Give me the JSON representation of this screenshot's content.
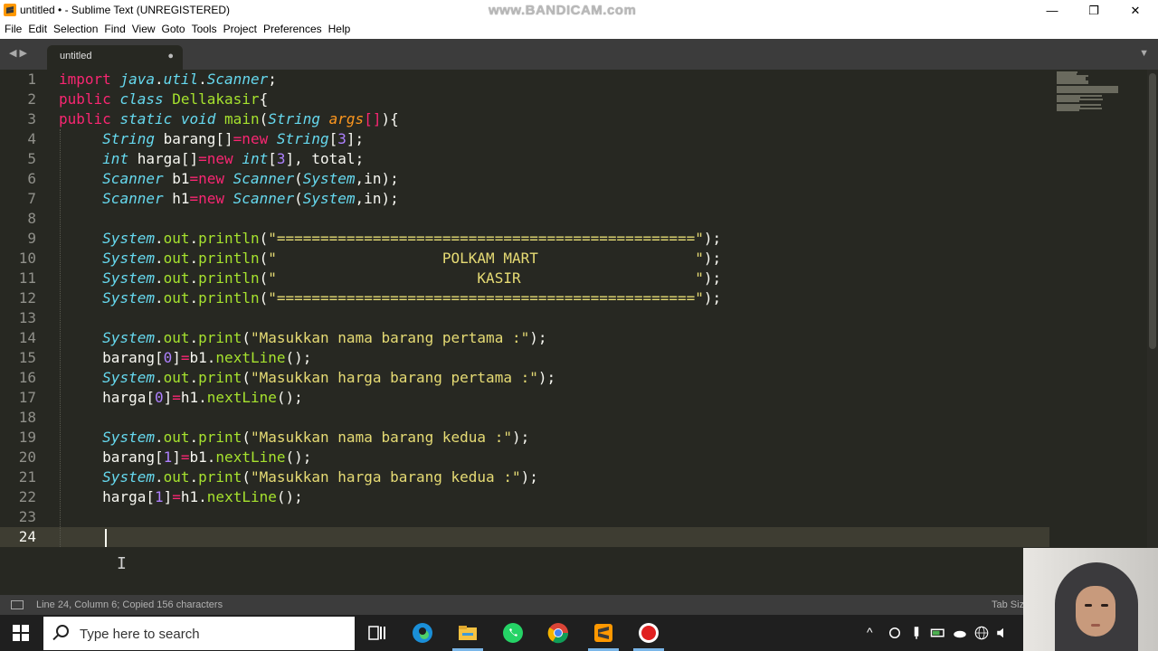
{
  "window": {
    "title": "untitled • - Sublime Text (UNREGISTERED)",
    "watermark": "www.BANDICAM.com",
    "minimize_glyph": "—",
    "maximize_glyph": "❐",
    "close_glyph": "✕"
  },
  "menu": [
    "File",
    "Edit",
    "Selection",
    "Find",
    "View",
    "Goto",
    "Tools",
    "Project",
    "Preferences",
    "Help"
  ],
  "tabbar": {
    "nav_glyph": "◀ ▶",
    "tab_label": "untitled",
    "tab_dirty_glyph": "●",
    "dropdown_glyph": "▼"
  },
  "editor": {
    "line_numbers": [
      "1",
      "2",
      "3",
      "4",
      "5",
      "6",
      "7",
      "8",
      "9",
      "10",
      "11",
      "12",
      "13",
      "14",
      "15",
      "16",
      "17",
      "18",
      "19",
      "20",
      "21",
      "22",
      "23",
      "24"
    ],
    "current_line": "24",
    "code_lines": [
      [
        [
          "k",
          "import "
        ],
        [
          "t",
          "java"
        ],
        [
          "",
          "."
        ],
        [
          "t",
          "util"
        ],
        [
          "",
          "."
        ],
        [
          "t",
          "Scanner"
        ],
        [
          "",
          ";"
        ]
      ],
      [
        [
          "k",
          "public "
        ],
        [
          "t",
          "class "
        ],
        [
          "f",
          "Dellakasir"
        ],
        [
          "",
          "{"
        ]
      ],
      [
        [
          "k",
          "public "
        ],
        [
          "t",
          "static "
        ],
        [
          "t",
          "void "
        ],
        [
          "f",
          "main"
        ],
        [
          "",
          "("
        ],
        [
          "t",
          "String "
        ],
        [
          "a",
          "args"
        ],
        [
          "k",
          "[]"
        ],
        [
          "",
          ")"
        ],
        [
          "",
          "{"
        ]
      ],
      [
        [
          "",
          "     "
        ],
        [
          "t",
          "String "
        ],
        [
          "",
          "barang[]"
        ],
        [
          "k",
          "=new "
        ],
        [
          "t",
          "String"
        ],
        [
          "",
          "["
        ],
        [
          "n",
          "3"
        ],
        [
          "",
          "];"
        ]
      ],
      [
        [
          "",
          "     "
        ],
        [
          "t",
          "int "
        ],
        [
          "",
          "harga[]"
        ],
        [
          "k",
          "=new "
        ],
        [
          "t",
          "int"
        ],
        [
          "",
          "["
        ],
        [
          "n",
          "3"
        ],
        [
          "",
          "], total;"
        ]
      ],
      [
        [
          "",
          "     "
        ],
        [
          "t",
          "Scanner "
        ],
        [
          "",
          "b1"
        ],
        [
          "k",
          "=new "
        ],
        [
          "t",
          "Scanner"
        ],
        [
          "",
          "("
        ],
        [
          "t",
          "System"
        ],
        [
          "",
          ",in);"
        ]
      ],
      [
        [
          "",
          "     "
        ],
        [
          "t",
          "Scanner "
        ],
        [
          "",
          "h1"
        ],
        [
          "k",
          "=new "
        ],
        [
          "t",
          "Scanner"
        ],
        [
          "",
          "("
        ],
        [
          "t",
          "System"
        ],
        [
          "",
          ",in);"
        ]
      ],
      [],
      [
        [
          "",
          "     "
        ],
        [
          "t",
          "System"
        ],
        [
          "",
          "."
        ],
        [
          "f",
          "out"
        ],
        [
          "",
          "."
        ],
        [
          "f",
          "println"
        ],
        [
          "",
          "("
        ],
        [
          "s",
          "\"================================================\""
        ],
        [
          "",
          ");"
        ]
      ],
      [
        [
          "",
          "     "
        ],
        [
          "t",
          "System"
        ],
        [
          "",
          "."
        ],
        [
          "f",
          "out"
        ],
        [
          "",
          "."
        ],
        [
          "f",
          "println"
        ],
        [
          "",
          "("
        ],
        [
          "s",
          "\"                   POLKAM MART                  \""
        ],
        [
          "",
          ");"
        ]
      ],
      [
        [
          "",
          "     "
        ],
        [
          "t",
          "System"
        ],
        [
          "",
          "."
        ],
        [
          "f",
          "out"
        ],
        [
          "",
          "."
        ],
        [
          "f",
          "println"
        ],
        [
          "",
          "("
        ],
        [
          "s",
          "\"                       KASIR                    \""
        ],
        [
          "",
          ");"
        ]
      ],
      [
        [
          "",
          "     "
        ],
        [
          "t",
          "System"
        ],
        [
          "",
          "."
        ],
        [
          "f",
          "out"
        ],
        [
          "",
          "."
        ],
        [
          "f",
          "println"
        ],
        [
          "",
          "("
        ],
        [
          "s",
          "\"================================================\""
        ],
        [
          "",
          ");"
        ]
      ],
      [],
      [
        [
          "",
          "     "
        ],
        [
          "t",
          "System"
        ],
        [
          "",
          "."
        ],
        [
          "f",
          "out"
        ],
        [
          "",
          "."
        ],
        [
          "f",
          "print"
        ],
        [
          "",
          "("
        ],
        [
          "s",
          "\"Masukkan nama barang pertama :\""
        ],
        [
          "",
          ");"
        ]
      ],
      [
        [
          "",
          "     barang["
        ],
        [
          "n",
          "0"
        ],
        [
          "",
          "]"
        ],
        [
          "k",
          "="
        ],
        [
          "",
          "b1."
        ],
        [
          "f",
          "nextLine"
        ],
        [
          "",
          "();"
        ]
      ],
      [
        [
          "",
          "     "
        ],
        [
          "t",
          "System"
        ],
        [
          "",
          "."
        ],
        [
          "f",
          "out"
        ],
        [
          "",
          "."
        ],
        [
          "f",
          "print"
        ],
        [
          "",
          "("
        ],
        [
          "s",
          "\"Masukkan harga barang pertama :\""
        ],
        [
          "",
          ");"
        ]
      ],
      [
        [
          "",
          "     harga["
        ],
        [
          "n",
          "0"
        ],
        [
          "",
          "]"
        ],
        [
          "k",
          "="
        ],
        [
          "",
          "h1."
        ],
        [
          "f",
          "nextLine"
        ],
        [
          "",
          "();"
        ]
      ],
      [],
      [
        [
          "",
          "     "
        ],
        [
          "t",
          "System"
        ],
        [
          "",
          "."
        ],
        [
          "f",
          "out"
        ],
        [
          "",
          "."
        ],
        [
          "f",
          "print"
        ],
        [
          "",
          "("
        ],
        [
          "s",
          "\"Masukkan nama barang kedua :\""
        ],
        [
          "",
          ");"
        ]
      ],
      [
        [
          "",
          "     barang["
        ],
        [
          "n",
          "1"
        ],
        [
          "",
          "]"
        ],
        [
          "k",
          "="
        ],
        [
          "",
          "b1."
        ],
        [
          "f",
          "nextLine"
        ],
        [
          "",
          "();"
        ]
      ],
      [
        [
          "",
          "     "
        ],
        [
          "t",
          "System"
        ],
        [
          "",
          "."
        ],
        [
          "f",
          "out"
        ],
        [
          "",
          "."
        ],
        [
          "f",
          "print"
        ],
        [
          "",
          "("
        ],
        [
          "s",
          "\"Masukkan harga barang kedua :\""
        ],
        [
          "",
          ");"
        ]
      ],
      [
        [
          "",
          "     harga["
        ],
        [
          "n",
          "1"
        ],
        [
          "",
          "]"
        ],
        [
          "k",
          "="
        ],
        [
          "",
          "h1."
        ],
        [
          "f",
          "nextLine"
        ],
        [
          "",
          "();"
        ]
      ],
      [],
      []
    ]
  },
  "statusbar": {
    "text": "Line 24, Column 6; Copied 156 characters",
    "tab_size": "Tab Siz"
  },
  "taskbar": {
    "search_placeholder": "Type here to search",
    "apps": [
      "task-view",
      "edge",
      "file-explorer",
      "whatsapp",
      "chrome",
      "sublime-text",
      "bandicam"
    ],
    "tray_chevron": "^"
  }
}
